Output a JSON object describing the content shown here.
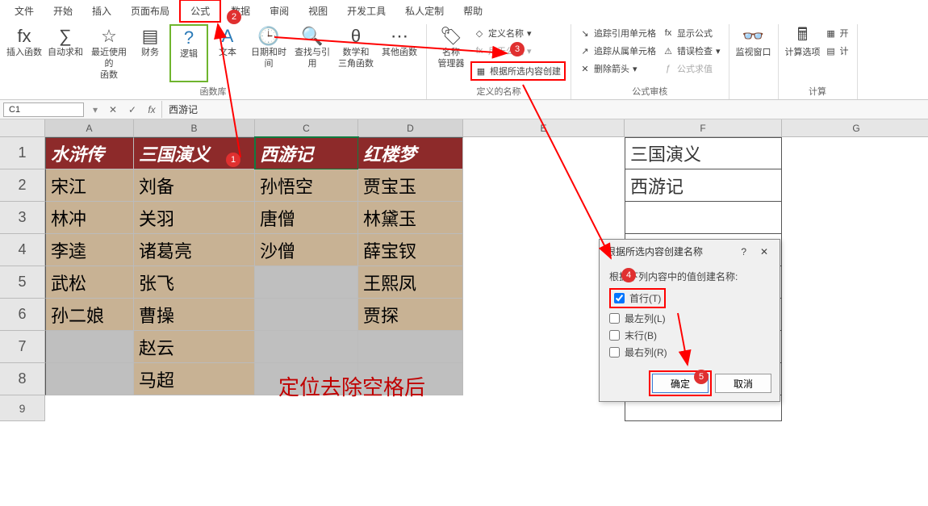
{
  "menu": {
    "file": "文件",
    "home": "开始",
    "insert": "插入",
    "page_layout": "页面布局",
    "formula": "公式",
    "data": "数据",
    "review": "审阅",
    "view": "视图",
    "developer": "开发工具",
    "custom": "私人定制",
    "help": "帮助"
  },
  "ribbon": {
    "insert_function": "插入函数",
    "auto_sum": "自动求和",
    "recent": "最近使用的\n函数",
    "finance": "财务",
    "logic": "逻辑",
    "text": "文本",
    "date_time": "日期和时间",
    "lookup": "查找与引用",
    "math": "数学和\n三角函数",
    "other": "其他函数",
    "name_mgr": "名称\n管理器",
    "define_name": "定义名称",
    "use_in_formula": "用于公式",
    "create_from_selection": "根据所选内容创建",
    "trace_precedents": "追踪引用单元格",
    "trace_dependents": "追踪从属单元格",
    "remove_arrows": "删除箭头",
    "show_formulas": "显示公式",
    "error_checking": "错误检查",
    "evaluate": "公式求值",
    "watch": "监视窗口",
    "calc_options": "计算选项",
    "open_calc": "开",
    "calc_sheet": "计",
    "group_lib": "函数库",
    "group_names": "定义的名称",
    "group_audit": "公式审核",
    "group_calc": "计算"
  },
  "namebox": "C1",
  "fbar_label": "fx",
  "formula_value": "西游记",
  "columns": [
    "A",
    "B",
    "C",
    "D",
    "E",
    "F",
    "G"
  ],
  "rows": [
    "1",
    "2",
    "3",
    "4",
    "5",
    "6",
    "7",
    "8",
    "9"
  ],
  "table": {
    "headers": [
      "水浒传",
      "三国演义",
      "西游记",
      "红楼梦"
    ],
    "data": [
      [
        "宋江",
        "刘备",
        "孙悟空",
        "贾宝玉"
      ],
      [
        "林冲",
        "关羽",
        "唐僧",
        "林黛玉"
      ],
      [
        "李逵",
        "诸葛亮",
        "沙僧",
        "薛宝钗"
      ],
      [
        "武松",
        "张飞",
        "",
        "王熙凤"
      ],
      [
        "孙二娘",
        "曹操",
        "",
        "贾探"
      ],
      [
        "",
        "赵云",
        "",
        ""
      ],
      [
        "",
        "马超",
        "",
        ""
      ]
    ]
  },
  "side_values": {
    "f1": "三国演义",
    "f2": "西游记"
  },
  "annotation": "定位去除空格后",
  "dialog": {
    "title": "根据所选内容创建名称",
    "instruction": "根据下列内容中的值创建名称:",
    "top_row": "首行(T)",
    "left_col": "最左列(L)",
    "bottom_row": "末行(B)",
    "right_col": "最右列(R)",
    "ok": "确定",
    "cancel": "取消"
  },
  "badges": {
    "b1": "1",
    "b2": "2",
    "b3": "3",
    "b4": "4",
    "b5": "5"
  }
}
